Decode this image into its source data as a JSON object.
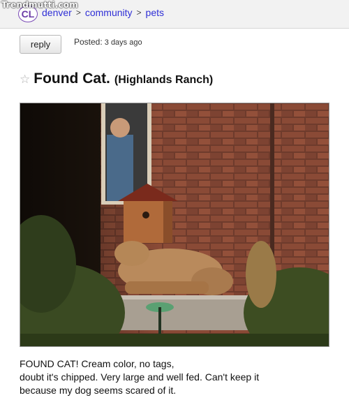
{
  "watermark": "Trendmutti.com",
  "header": {
    "logo": "CL",
    "breadcrumb": [
      "denver",
      "community",
      "pets"
    ],
    "separator": ">"
  },
  "post_bar": {
    "reply_label": "reply",
    "posted_label": "Posted:",
    "posted_value": "3 days ago"
  },
  "posting": {
    "favorite_icon": "star-outline-icon",
    "title": "Found Cat.",
    "location": "(Highlands Ranch)",
    "image_alt": "photo of a large cream-colored animal lying on a porch step beside a birdhouse in front of a brick house",
    "description_lines": [
      "FOUND CAT! Cream color, no tags,",
      "doubt it's chipped. Very large and well fed. Can't keep it",
      "because my dog seems scared of it."
    ]
  },
  "colors": {
    "link": "#2f2fd6",
    "logo": "#6a3aa6",
    "topbar_bg": "#f2f2f2"
  }
}
